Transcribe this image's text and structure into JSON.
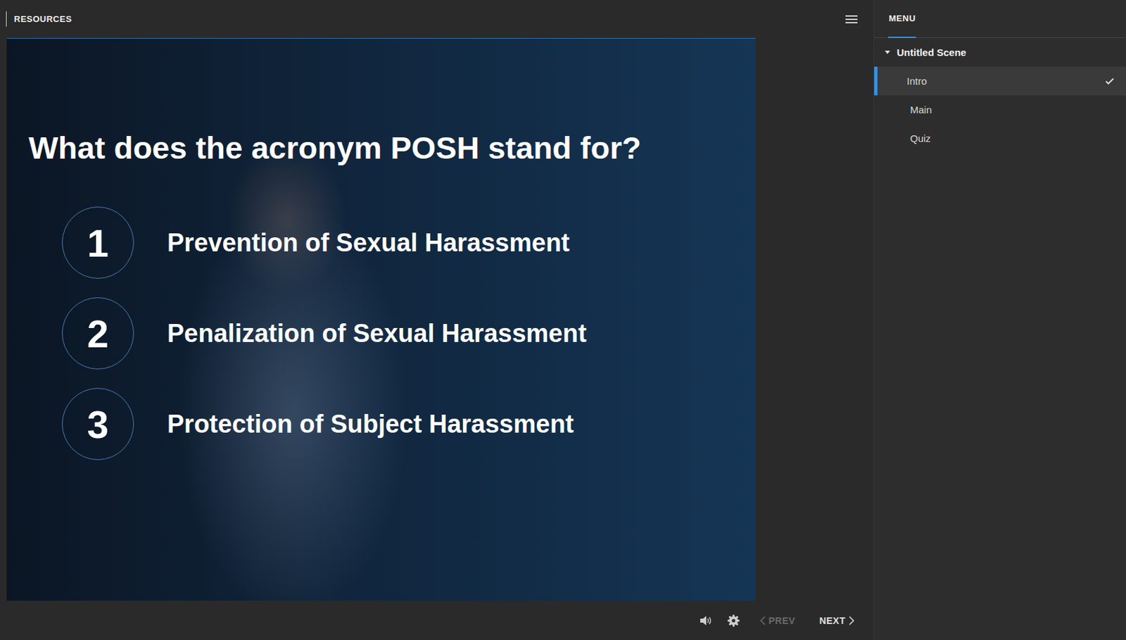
{
  "topbar": {
    "resources": "RESOURCES"
  },
  "slide": {
    "question": "What does the acronym POSH stand for?",
    "options": [
      {
        "number": "1",
        "text": "Prevention of Sexual Harassment"
      },
      {
        "number": "2",
        "text": "Penalization of Sexual Harassment"
      },
      {
        "number": "3",
        "text": "Protection of Subject Harassment"
      }
    ]
  },
  "menu": {
    "tab": "MENU",
    "scene": {
      "title": "Untitled Scene",
      "expanded": true
    },
    "items": [
      {
        "label": "Intro",
        "selected": true,
        "visited": true
      },
      {
        "label": "Main",
        "selected": false,
        "visited": false
      },
      {
        "label": "Quiz",
        "selected": false,
        "visited": false
      }
    ]
  },
  "controls": {
    "prev": {
      "label": "PREV",
      "disabled": true
    },
    "next": {
      "label": "NEXT",
      "disabled": false
    }
  }
}
